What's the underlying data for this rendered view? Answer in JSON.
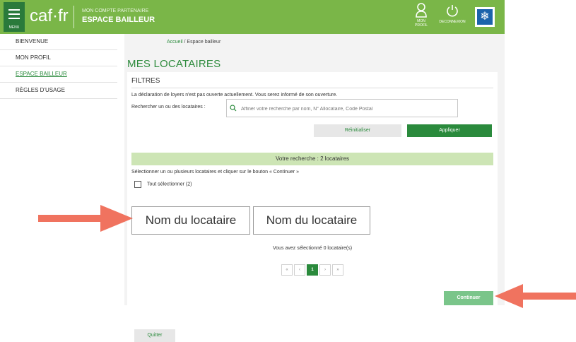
{
  "header": {
    "menu_label": "MENU",
    "logo_text": "caf·fr",
    "subtitle": "MON COMPTE PARTENAIRE",
    "title": "ESPACE BAILLEUR",
    "profile_label": "MON PROFIL",
    "logout_label": "DECONNEXION",
    "brand_color": "#7ab648"
  },
  "sidebar": {
    "items": [
      {
        "label": "BIENVENUE"
      },
      {
        "label": "MON PROFIL"
      },
      {
        "label": "ESPACE BAILLEUR"
      },
      {
        "label": "RÈGLES D'USAGE"
      }
    ]
  },
  "breadcrumb": {
    "home": "Accueil",
    "current": " / Espace bailleur"
  },
  "page": {
    "title": "MES LOCATAIRES"
  },
  "filters": {
    "heading": "FILTRES",
    "info": "La déclaration de loyers n'est pas ouverte actuellement. Vous serez informé de son ouverture.",
    "search_label": "Rechercher un ou des locataires :",
    "search_placeholder": "Affiner votre recherche par nom, N° Allocataire, Code Postal",
    "reset_label": "Réinitialiser",
    "apply_label": "Appliquer"
  },
  "results": {
    "summary": "Votre recherche : 2 locataires",
    "hint": "Sélectionner un ou plusieurs locataires et cliquer sur le bouton « Continuer »",
    "select_all": "Tout sélectionner (2)",
    "tenants": [
      {
        "name": "Nom du locataire"
      },
      {
        "name": "Nom du locataire"
      }
    ],
    "selected_count": "Vous avez sélectionné 0 locataire(s)"
  },
  "pagination": {
    "first": "«",
    "prev": "‹",
    "current": "1",
    "next": "›",
    "last": "»"
  },
  "actions": {
    "quit_label": "Quitter",
    "continue_label": "Continuer"
  },
  "colors": {
    "accent_green": "#2a8a3c",
    "highlight_arrow": "#f0735f"
  }
}
